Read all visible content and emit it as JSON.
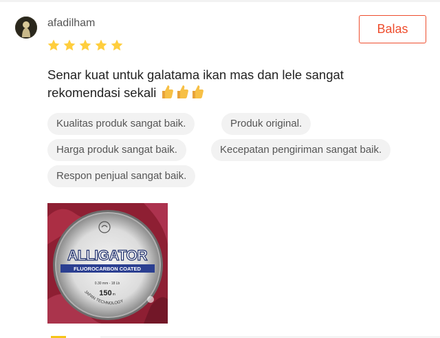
{
  "review": {
    "username": "afadilham",
    "rating": 5,
    "rating_max": 5,
    "reply_label": "Balas",
    "comment": "Senar kuat untuk galatama ikan mas dan lele sangat rekomendasi sekali",
    "emoji": [
      "thumbs-up-icon",
      "thumbs-up-icon",
      "thumbs-up-icon"
    ],
    "tags": [
      "Kualitas produk sangat baik.",
      "Produk original.",
      "Harga produk sangat baik.",
      "Kecepatan pengiriman sangat baik.",
      "Respon penjual sangat baik."
    ],
    "photo": {
      "brand": "ALLIGATOR",
      "subtitle": "FLUOROCARBON COATED",
      "spec": "0.30 mm - 18 Lb",
      "length": "150",
      "length_unit": "m",
      "origin": "JAPAN TECHNOLOGY"
    }
  },
  "colors": {
    "accent": "#ee4d2d",
    "star": "#ffce3d",
    "tag_bg": "#f2f2f2"
  }
}
